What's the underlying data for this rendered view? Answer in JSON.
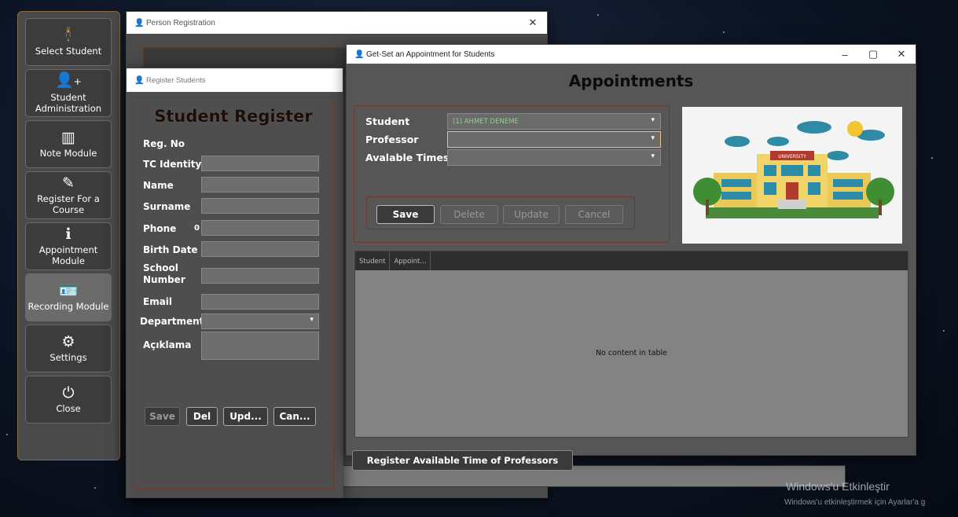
{
  "sidebar": {
    "items": [
      {
        "label": "Select Student",
        "icon": "person-icon"
      },
      {
        "label": "Student Administration",
        "icon": "add-user-icon"
      },
      {
        "label": "Note Module",
        "icon": "map-icon"
      },
      {
        "label": "Register For a Course",
        "icon": "pencil-icon"
      },
      {
        "label": "Appointment Module",
        "icon": "info-icon"
      },
      {
        "label": "Recording Module",
        "icon": "id-card-icon"
      },
      {
        "label": "Settings",
        "icon": "gear-icon"
      },
      {
        "label": "Close",
        "icon": "power-icon"
      }
    ]
  },
  "person_window": {
    "title": "Person Registration"
  },
  "register_window": {
    "title": "Register Students",
    "heading": "Student Register",
    "labels": {
      "reg_no": "Reg. No",
      "tc": "TC Identity",
      "name": "Name",
      "surname": "Surname",
      "phone": "Phone",
      "phone_value": "0",
      "birth": "Birth Date",
      "school": "School Number",
      "email": "Email",
      "department": "Department",
      "aciklama": "Açıklama"
    },
    "buttons": {
      "save": "Save",
      "del": "Del",
      "upd": "Upd...",
      "can": "Can..."
    }
  },
  "appointment_window": {
    "title": "Get-Set an Appointment for Students",
    "heading": "Appointments",
    "labels": {
      "student": "Student",
      "professor": "Professor",
      "times": "Avalable Times"
    },
    "student_value": "(1) AHMET DENEME",
    "buttons": {
      "save": "Save",
      "delete": "Delete",
      "update": "Update",
      "cancel": "Cancel"
    },
    "image_sign": "UNIVERSITY",
    "table": {
      "columns": [
        "Student",
        "Appoint..."
      ],
      "empty": "No content in table"
    },
    "register_button": "Register Available Time of Professors"
  },
  "watermark": {
    "line1": "Windows'u Etkinleştir",
    "line2": "Windows'u etkinleştirmek için Ayarlar'a g"
  },
  "colors": {
    "sidebar_bg": "#4a4a4a",
    "accent_border": "#6a3a30",
    "combo_highlight": "#e3c38a"
  }
}
